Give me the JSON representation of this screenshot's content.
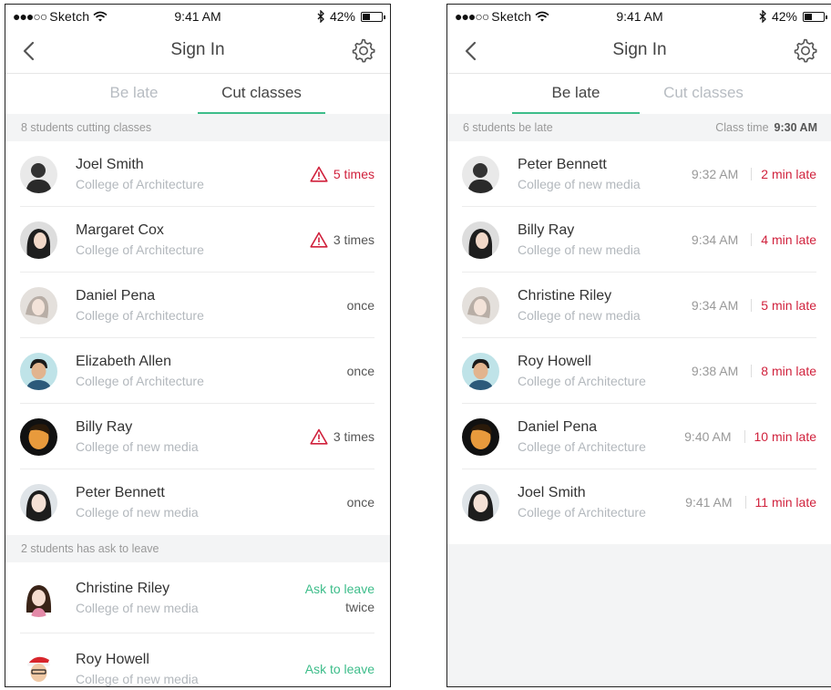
{
  "status": {
    "carrier": "Sketch",
    "time": "9:41 AM",
    "battery": "42%"
  },
  "colors": {
    "accent_green": "#3dbd8a",
    "alert_red": "#d0213c"
  },
  "left": {
    "nav": {
      "title": "Sign In"
    },
    "tabs": [
      "Be late",
      "Cut classes"
    ],
    "active_tab": "Cut classes",
    "section1": {
      "label": "8 students cutting classes"
    },
    "cut_rows": [
      {
        "name": "Joel Smith",
        "college": "College of Architecture",
        "count": "5 times",
        "warn": true,
        "red": true
      },
      {
        "name": "Margaret Cox",
        "college": "College of Architecture",
        "count": "3 times",
        "warn": true,
        "red": false
      },
      {
        "name": "Daniel Pena",
        "college": "College of Architecture",
        "count": "once",
        "warn": false,
        "red": false
      },
      {
        "name": "Elizabeth Allen",
        "college": "College of Architecture",
        "count": "once",
        "warn": false,
        "red": false
      },
      {
        "name": "Billy Ray",
        "college": "College of new media",
        "count": "3 times",
        "warn": true,
        "red": false
      },
      {
        "name": "Peter Bennett",
        "college": "College of new media",
        "count": "once",
        "warn": false,
        "red": false
      }
    ],
    "section2": {
      "label": "2 students has ask to leave"
    },
    "leave_rows": [
      {
        "name": "Christine Riley",
        "college": "College of new media",
        "status": "Ask to leave",
        "count": "twice"
      },
      {
        "name": "Roy Howell",
        "college": "College of new media",
        "status": "Ask to leave",
        "count": ""
      }
    ]
  },
  "right": {
    "nav": {
      "title": "Sign In"
    },
    "tabs": [
      "Be late",
      "Cut classes"
    ],
    "active_tab": "Be late",
    "section": {
      "label": "6 students be late",
      "class_time_label": "Class time",
      "class_time_value": "9:30 AM"
    },
    "late_rows": [
      {
        "name": "Peter Bennett",
        "college": "College of new media",
        "arrival": "9:32 AM",
        "late": "2 min late"
      },
      {
        "name": "Billy Ray",
        "college": "College of new media",
        "arrival": "9:34 AM",
        "late": "4 min late"
      },
      {
        "name": "Christine Riley",
        "college": "College of new media",
        "arrival": "9:34 AM",
        "late": "5 min late"
      },
      {
        "name": "Roy Howell",
        "college": "College of Architecture",
        "arrival": "9:38 AM",
        "late": "8 min late"
      },
      {
        "name": "Daniel Pena",
        "college": "College of Architecture",
        "arrival": "9:40 AM",
        "late": "10 min late"
      },
      {
        "name": "Joel Smith",
        "college": "College of Architecture",
        "arrival": "9:41 AM",
        "late": "11 min late"
      }
    ]
  }
}
